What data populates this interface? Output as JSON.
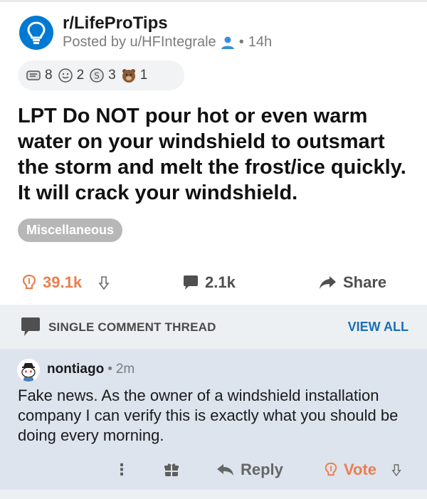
{
  "post": {
    "subreddit": "r/LifeProTips",
    "posted_prefix": "Posted by u/HFIntegrale",
    "time_sep": "•",
    "time": "14h",
    "awards": [
      {
        "name": "scroll-award-icon",
        "count": "8"
      },
      {
        "name": "wholesome-award-icon",
        "count": "2"
      },
      {
        "name": "silver-award-icon",
        "count": "3"
      },
      {
        "name": "bear-award-icon",
        "count": "1"
      }
    ],
    "title": "LPT Do NOT pour hot or even warm water on your windshield to outsmart the storm and melt the frost/ice quickly. It will crack your windshield.",
    "flair": "Miscellaneous",
    "actions": {
      "score": "39.1k",
      "comments": "2.1k",
      "share": "Share"
    }
  },
  "thread": {
    "label": "SINGLE COMMENT THREAD",
    "view_all": "VIEW ALL"
  },
  "comment": {
    "user": "nontiago",
    "sep": "•",
    "time": "2m",
    "body": "Fake news. As the owner of a windshield installation company I can verify this is exactly what you should be doing every morning.",
    "more": "⋮",
    "reply": "Reply",
    "vote": "Vote"
  },
  "colors": {
    "upvote_orange": "#e8804f",
    "link_blue": "#1a6fb5",
    "subreddit_blue": "#0079d3",
    "comment_bg": "#dde4ee",
    "flair_gray": "#b7b7b7"
  }
}
